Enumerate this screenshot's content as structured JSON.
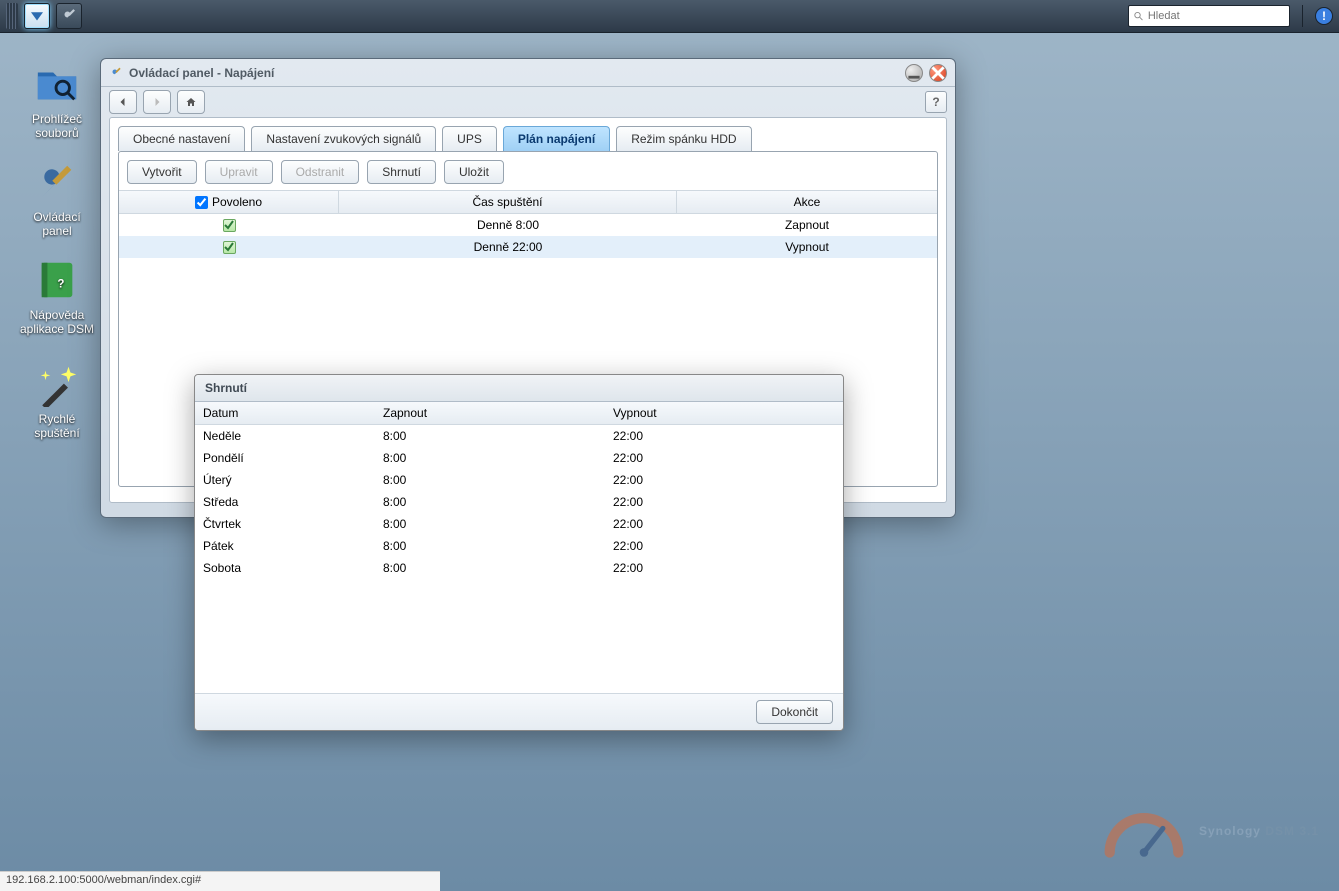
{
  "taskbar": {
    "search_placeholder": "Hledat"
  },
  "desktop": [
    {
      "name": "file-station",
      "label": "Prohlížeč\nsouborů"
    },
    {
      "name": "control-panel",
      "label": "Ovládací\npanel"
    },
    {
      "name": "dsm-help",
      "label": "Nápověda\naplikace DSM"
    },
    {
      "name": "quick-start",
      "label": "Rychlé\nspuštění"
    }
  ],
  "window": {
    "title": "Ovládací panel - Napájení",
    "tabs": [
      {
        "label": "Obecné nastavení"
      },
      {
        "label": "Nastavení zvukových signálů"
      },
      {
        "label": "UPS"
      },
      {
        "label": "Plán napájení",
        "active": true
      },
      {
        "label": "Režim spánku HDD"
      }
    ],
    "buttons": {
      "create": "Vytvořit",
      "edit": "Upravit",
      "delete": "Odstranit",
      "summary": "Shrnutí",
      "save": "Uložit"
    },
    "grid": {
      "col_enabled": "Povoleno",
      "col_time": "Čas spuštění",
      "col_action": "Akce",
      "rows": [
        {
          "enabled": true,
          "time": "Denně 8:00",
          "action": "Zapnout"
        },
        {
          "enabled": true,
          "time": "Denně 22:00",
          "action": "Vypnout",
          "selected": true
        }
      ]
    }
  },
  "dialog": {
    "title": "Shrnutí",
    "col_date": "Datum",
    "col_on": "Zapnout",
    "col_off": "Vypnout",
    "rows": [
      {
        "day": "Neděle",
        "on": "8:00",
        "off": "22:00"
      },
      {
        "day": "Pondělí",
        "on": "8:00",
        "off": "22:00"
      },
      {
        "day": "Úterý",
        "on": "8:00",
        "off": "22:00"
      },
      {
        "day": "Středa",
        "on": "8:00",
        "off": "22:00"
      },
      {
        "day": "Čtvrtek",
        "on": "8:00",
        "off": "22:00"
      },
      {
        "day": "Pátek",
        "on": "8:00",
        "off": "22:00"
      },
      {
        "day": "Sobota",
        "on": "8:00",
        "off": "22:00"
      }
    ],
    "close": "Dokončit"
  },
  "watermark": {
    "brand": "Synology",
    "product": "DSM 3.1"
  },
  "statusbar": "192.168.2.100:5000/webman/index.cgi#"
}
